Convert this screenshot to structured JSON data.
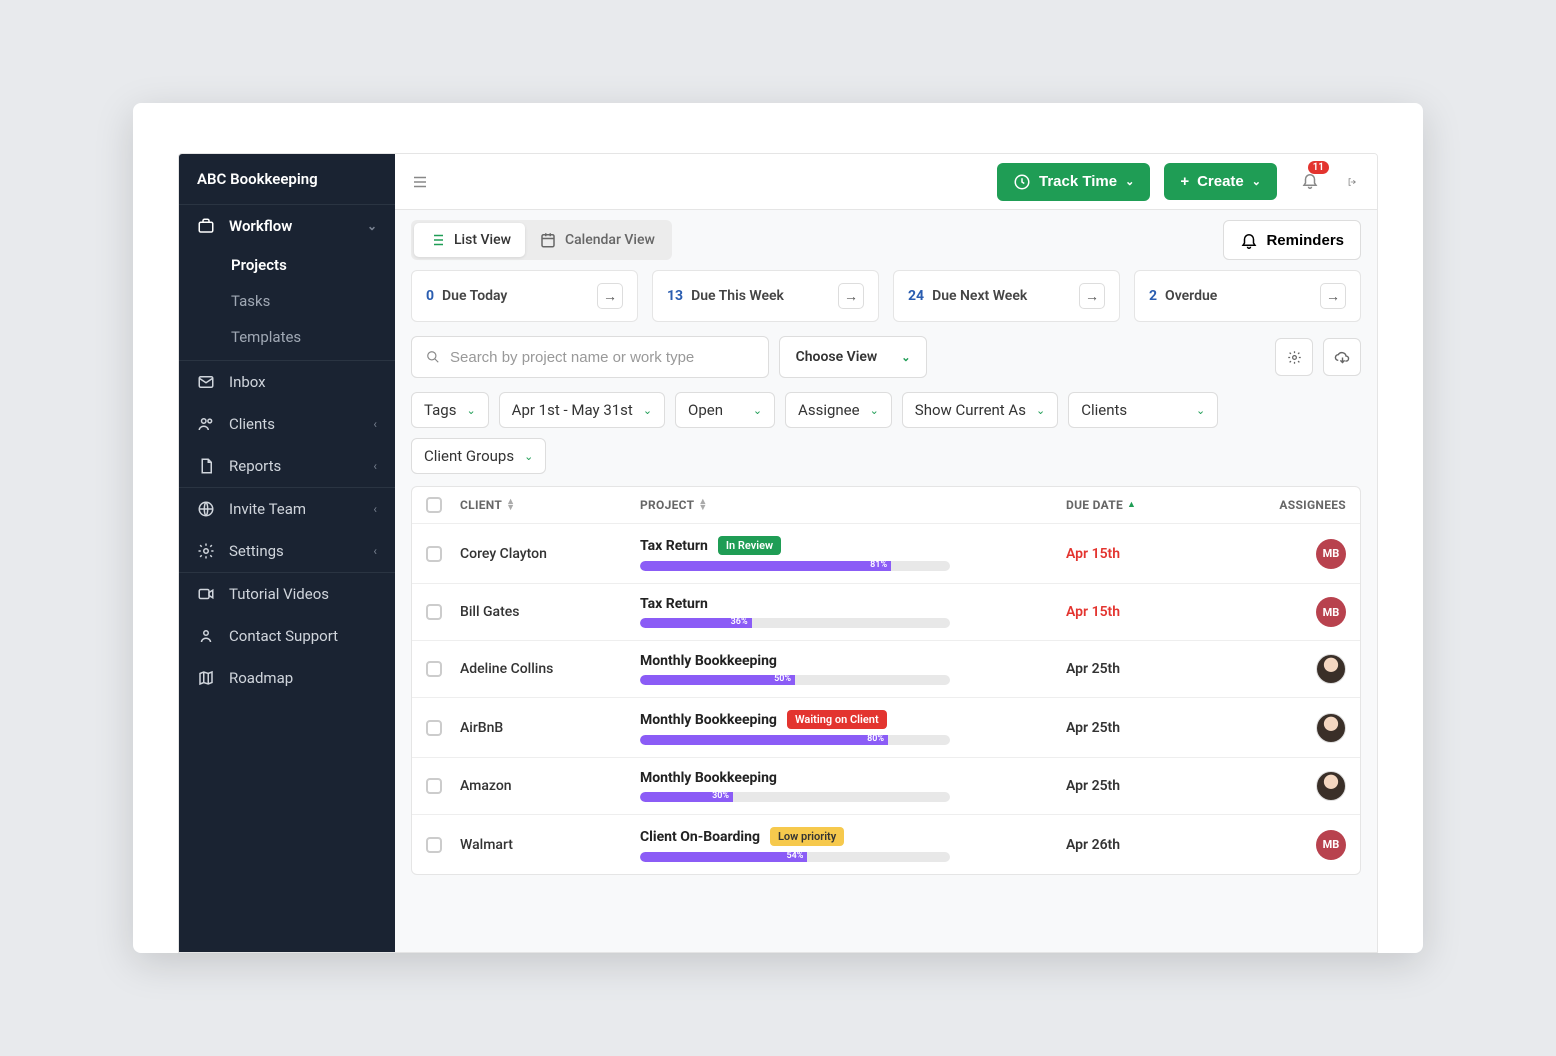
{
  "app_title": "ABC Bookkeeping",
  "sidebar": {
    "workflow": {
      "label": "Workflow",
      "projects": "Projects",
      "tasks": "Tasks",
      "templates": "Templates"
    },
    "inbox": "Inbox",
    "clients": "Clients",
    "reports": "Reports",
    "invite": "Invite Team",
    "settings": "Settings",
    "tutorial": "Tutorial Videos",
    "support": "Contact Support",
    "roadmap": "Roadmap"
  },
  "topbar": {
    "track_time": "Track Time",
    "create": "Create",
    "notifications": "11"
  },
  "views": {
    "list": "List View",
    "calendar": "Calendar View",
    "reminders": "Reminders"
  },
  "stats": [
    {
      "count": "0",
      "label": "Due Today"
    },
    {
      "count": "13",
      "label": "Due This Week"
    },
    {
      "count": "24",
      "label": "Due Next Week"
    },
    {
      "count": "2",
      "label": "Overdue"
    }
  ],
  "search": {
    "placeholder": "Search by project name or work type",
    "choose_view": "Choose View"
  },
  "filters": {
    "tags": "Tags",
    "daterange": "Apr 1st - May 31st",
    "status": "Open",
    "assignee": "Assignee",
    "show_current": "Show Current As",
    "clients": "Clients",
    "client_groups": "Client Groups"
  },
  "columns": {
    "client": "CLIENT",
    "project": "PROJECT",
    "due": "DUE DATE",
    "assignees": "ASSIGNEES"
  },
  "rows": [
    {
      "client": "Corey Clayton",
      "project": "Tax Return",
      "tag": "In Review",
      "tag_color": "green",
      "progress": 81,
      "progress_label": "81%",
      "due": "Apr 15th",
      "due_red": true,
      "avatar_type": "mb",
      "avatar_text": "MB"
    },
    {
      "client": "Bill Gates",
      "project": "Tax Return",
      "tag": "",
      "tag_color": "",
      "progress": 36,
      "progress_label": "36%",
      "due": "Apr 15th",
      "due_red": true,
      "avatar_type": "mb",
      "avatar_text": "MB"
    },
    {
      "client": "Adeline Collins",
      "project": "Monthly Bookkeeping",
      "tag": "",
      "tag_color": "",
      "progress": 50,
      "progress_label": "50%",
      "due": "Apr 25th",
      "due_red": false,
      "avatar_type": "img",
      "avatar_text": ""
    },
    {
      "client": "AirBnB",
      "project": "Monthly Bookkeeping",
      "tag": "Waiting on Client",
      "tag_color": "red",
      "progress": 80,
      "progress_label": "80%",
      "due": "Apr 25th",
      "due_red": false,
      "avatar_type": "img",
      "avatar_text": ""
    },
    {
      "client": "Amazon",
      "project": "Monthly Bookkeeping",
      "tag": "",
      "tag_color": "",
      "progress": 30,
      "progress_label": "30%",
      "due": "Apr 25th",
      "due_red": false,
      "avatar_type": "img",
      "avatar_text": ""
    },
    {
      "client": "Walmart",
      "project": "Client On-Boarding",
      "tag": "Low priority",
      "tag_color": "yellow",
      "progress": 54,
      "progress_label": "54%",
      "due": "Apr 26th",
      "due_red": false,
      "avatar_type": "mb",
      "avatar_text": "MB"
    }
  ]
}
